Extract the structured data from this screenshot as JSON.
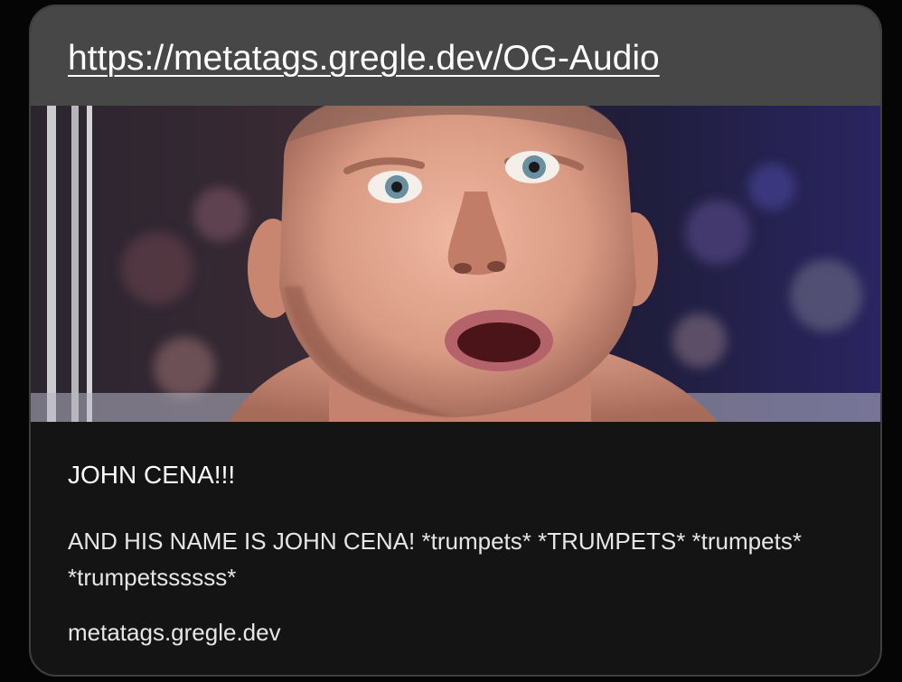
{
  "link_preview": {
    "url": "https://metatags.gregle.dev/OG-Audio",
    "image_description": "preview-image-surprised-face",
    "title": "JOHN CENA!!!",
    "description": "AND HIS NAME IS JOHN CENA! *trumpets* *TRUMPETS* *trumpets* *trumpetssssss*",
    "domain": "metatags.gregle.dev"
  },
  "colors": {
    "page_background": "#050505",
    "card_background": "#141414",
    "url_bar_background": "#474747",
    "text_primary": "#ffffff",
    "text_secondary": "#e6e6e6"
  }
}
